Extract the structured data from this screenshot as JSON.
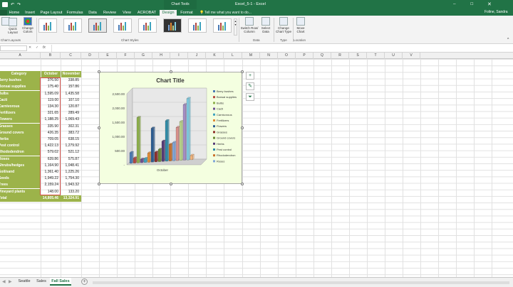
{
  "titlebar": {
    "chart_tools": "Chart Tools",
    "filename": "Excel_5-1 - Excel",
    "user": "Foline, Sandra"
  },
  "tabs": [
    "Home",
    "Insert",
    "Page Layout",
    "Formulas",
    "Data",
    "Review",
    "View",
    "ACROBAT",
    "Design",
    "Format"
  ],
  "tell_me": "Tell me what you want to do...",
  "ribbon": {
    "quick_layout": "Quick Layout",
    "change_colors": "Change Colors",
    "chart_layouts_group": "Chart Layouts",
    "chart_styles_group": "Chart Styles",
    "switch_row_column": "Switch Row/ Column",
    "select_data": "Select Data",
    "data_group": "Data",
    "change_chart_type": "Change Chart Type",
    "type_group": "Type",
    "move_chart": "Move Chart",
    "location_group": "Location"
  },
  "formula_bar": {
    "name_box": "",
    "fx": "fx",
    "value": ""
  },
  "columns": [
    "A",
    "B",
    "C",
    "D",
    "E",
    "F",
    "G",
    "H",
    "I",
    "J",
    "K",
    "L",
    "M",
    "N",
    "O",
    "P",
    "Q",
    "R",
    "S",
    "T",
    "U",
    "V"
  ],
  "table": {
    "header": [
      "Category",
      "October",
      "November"
    ],
    "rows": [
      [
        "Berry bushes",
        "376.50",
        "338.85"
      ],
      [
        "Bonsai supplies",
        "175.40",
        "157.86"
      ],
      [
        "Bulbs",
        "1,595.09",
        "1,435.58"
      ],
      [
        "Cacti",
        "119.00",
        "107.10"
      ],
      [
        "Carnivorous",
        "134.30",
        "120.87"
      ],
      [
        "Fertilizers",
        "321.65",
        "289.49"
      ],
      [
        "Flowers",
        "1,188.25",
        "1,069.43"
      ],
      [
        "Grasses",
        "335.90",
        "302.31"
      ],
      [
        "Ground covers",
        "426.35",
        "383.72"
      ],
      [
        "Herbs",
        "709.05",
        "638.15"
      ],
      [
        "Pest control",
        "1,422.13",
        "1,279.92"
      ],
      [
        "Rhododendron",
        "579.02",
        "521.12"
      ],
      [
        "Roses",
        "639.86",
        "575.87"
      ],
      [
        "Shrubs/hedges",
        "1,164.90",
        "1,048.41"
      ],
      [
        "Soil/sand",
        "1,361.40",
        "1,225.26"
      ],
      [
        "Seeds",
        "1,949.22",
        "1,754.30"
      ],
      [
        "Trees",
        "2,159.24",
        "1,943.32"
      ],
      [
        "Vineyard plants",
        "148.00",
        "133.20"
      ]
    ],
    "total": [
      "Total",
      "14,805.46",
      "13,324.91"
    ]
  },
  "chart_data": {
    "type": "bar",
    "title": "Chart Title",
    "categories": [
      "October"
    ],
    "ylim": [
      0,
      2500
    ],
    "yticks": [
      "-",
      "500.00",
      "1,000.00",
      "1,500.00",
      "2,000.00",
      "2,500.00"
    ],
    "series": [
      {
        "name": "Berry bushes",
        "values": [
          376.5
        ],
        "color": "#4a7ab5"
      },
      {
        "name": "Bonsai supplies",
        "values": [
          175.4
        ],
        "color": "#b5473f"
      },
      {
        "name": "Bulbs",
        "values": [
          1595.09
        ],
        "color": "#8db04a"
      },
      {
        "name": "Cacti",
        "values": [
          119.0
        ],
        "color": "#6e4f92"
      },
      {
        "name": "Carnivorous",
        "values": [
          134.3
        ],
        "color": "#3ea3bf"
      },
      {
        "name": "Fertilizers",
        "values": [
          321.65
        ],
        "color": "#e08a35"
      },
      {
        "name": "Flowers",
        "values": [
          1188.25
        ],
        "color": "#2c5c92"
      },
      {
        "name": "Grasses",
        "values": [
          335.9
        ],
        "color": "#8e2e2a"
      },
      {
        "name": "Ground covers",
        "values": [
          426.35
        ],
        "color": "#6a8a34"
      },
      {
        "name": "Herbs",
        "values": [
          709.05
        ],
        "color": "#563b77"
      },
      {
        "name": "Pest control",
        "values": [
          1422.13
        ],
        "color": "#2e8ba7"
      },
      {
        "name": "Rhododendron",
        "values": [
          579.02
        ],
        "color": "#c9702a"
      },
      {
        "name": "Roses",
        "values": [
          639.86
        ],
        "color": "#7fa5d8"
      }
    ],
    "extra_bars": [
      {
        "values": [
          1164.9
        ],
        "color": "#d98f8a"
      },
      {
        "values": [
          1361.4
        ],
        "color": "#b9d38a"
      },
      {
        "values": [
          1949.22
        ],
        "color": "#a48cc4"
      },
      {
        "values": [
          2159.24
        ],
        "color": "#7fcbe0"
      },
      {
        "values": [
          148.0
        ],
        "color": "#f3b37a"
      }
    ],
    "legend_position": "right",
    "grid": true
  },
  "sheets": [
    "Seattle",
    "Sales",
    "Fall Sales"
  ],
  "active_sheet": "Fall Sales"
}
